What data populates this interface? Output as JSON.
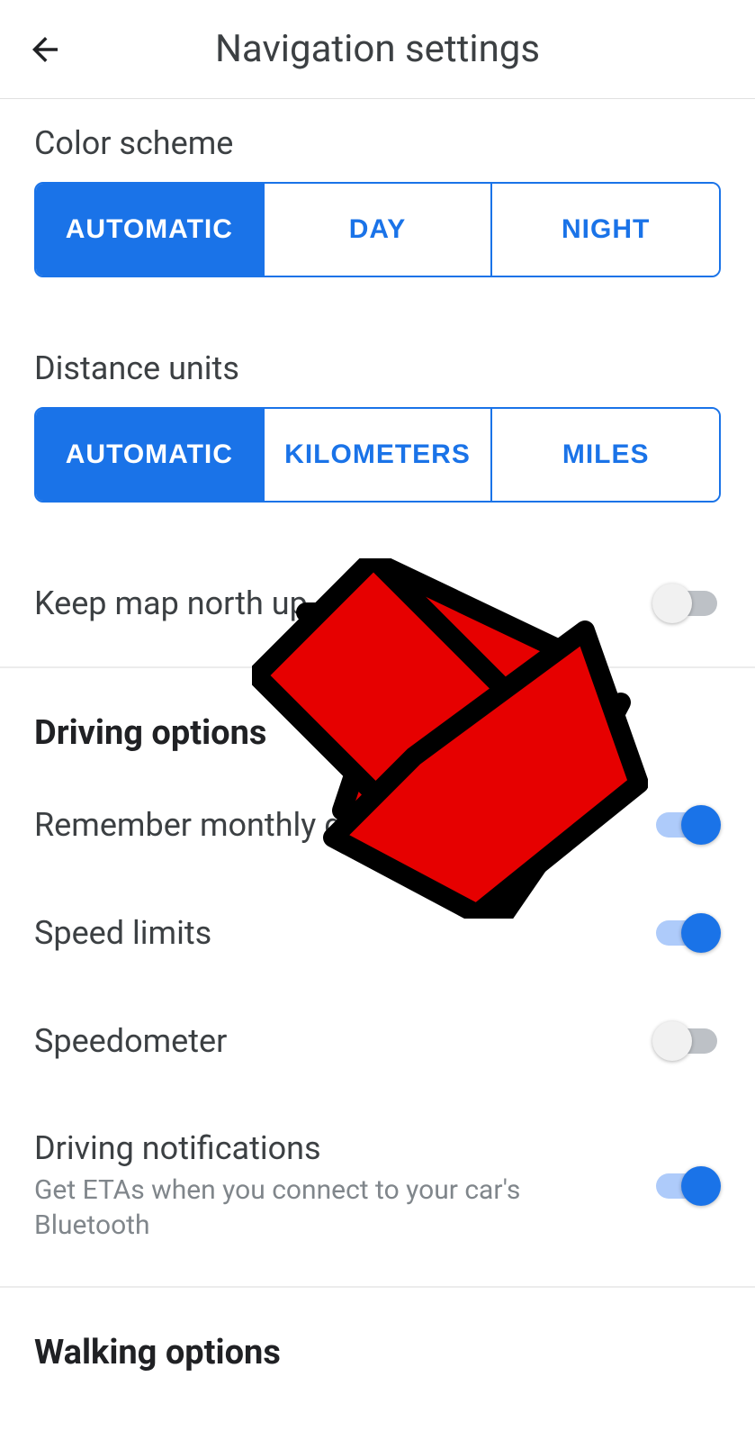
{
  "header": {
    "title": "Navigation settings"
  },
  "color_scheme": {
    "label": "Color scheme",
    "options": [
      "AUTOMATIC",
      "DAY",
      "NIGHT"
    ],
    "selected": 0
  },
  "distance_units": {
    "label": "Distance units",
    "options": [
      "AUTOMATIC",
      "KILOMETERS",
      "MILES"
    ],
    "selected": 0
  },
  "keep_north": {
    "label": "Keep map north up",
    "on": false
  },
  "driving": {
    "header": "Driving options",
    "items": [
      {
        "label": "Remember monthly driving",
        "subtitle": "",
        "on": true
      },
      {
        "label": "Speed limits",
        "subtitle": "",
        "on": true
      },
      {
        "label": "Speedometer",
        "subtitle": "",
        "on": false
      },
      {
        "label": "Driving notifications",
        "subtitle": "Get ETAs when you connect to your car's Bluetooth",
        "on": true
      }
    ]
  },
  "walking": {
    "header": "Walking options"
  }
}
